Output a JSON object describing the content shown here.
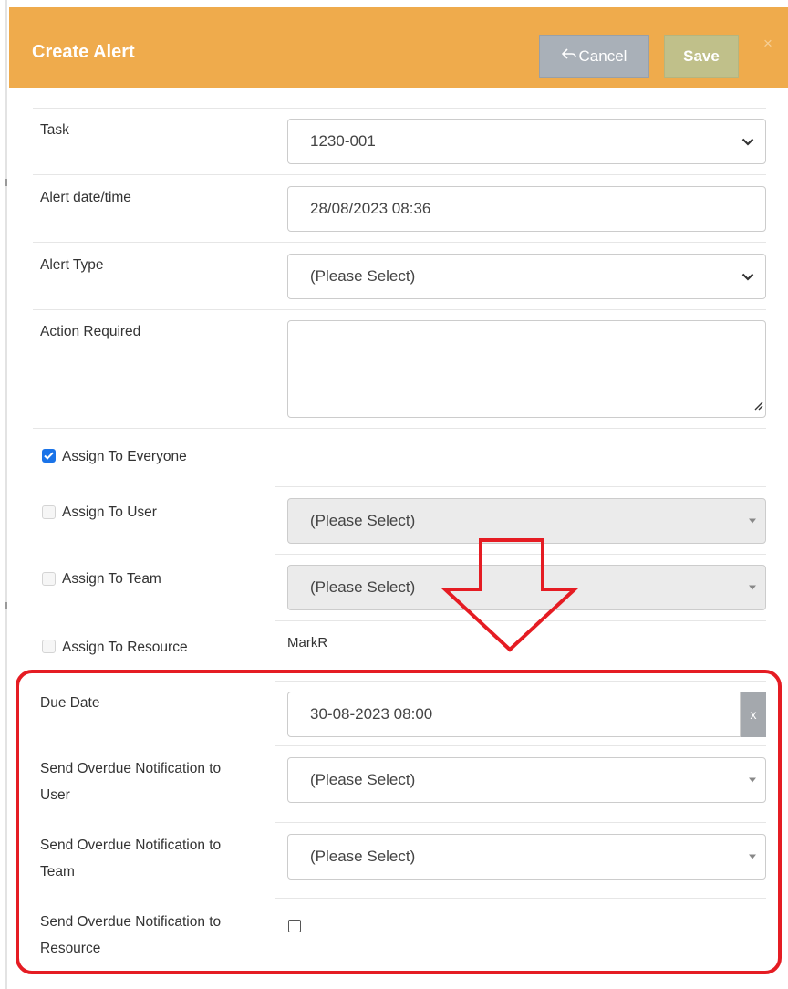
{
  "dialog": {
    "title": "Create Alert",
    "cancel_label": "Cancel",
    "save_label": "Save",
    "close_label": "×"
  },
  "form": {
    "task": {
      "label": "Task",
      "value": "1230-001"
    },
    "alert_datetime": {
      "label": "Alert date/time",
      "value": "28/08/2023 08:36"
    },
    "alert_type": {
      "label": "Alert Type",
      "value": "(Please Select)"
    },
    "action_required": {
      "label": "Action Required",
      "value": ""
    },
    "assign_everyone": {
      "label": "Assign To Everyone",
      "checked": true
    },
    "assign_user": {
      "label": "Assign To User",
      "value": "(Please Select)",
      "checked": false
    },
    "assign_team": {
      "label": "Assign To Team",
      "value": "(Please Select)",
      "checked": false
    },
    "assign_resource": {
      "label": "Assign To Resource",
      "value": "MarkR",
      "checked": false
    },
    "due_date": {
      "label": "Due Date",
      "value": "30-08-2023 08:00",
      "clear_label": "x"
    },
    "overdue_user": {
      "label_line1": "Send Overdue Notification to",
      "label_line2": "User",
      "value": "(Please Select)"
    },
    "overdue_team": {
      "label_line1": "Send Overdue Notification to",
      "label_line2": "Team",
      "value": "(Please Select)"
    },
    "overdue_resource": {
      "label_line1": "Send Overdue Notification to",
      "label_line2": "Resource",
      "checked": false
    }
  },
  "colors": {
    "header": "#efab4c",
    "cancel_button": "#a9b0b8",
    "save_button": "#c0c08a",
    "checkbox_checked": "#1a73e8",
    "annotation_red": "#e51c23"
  },
  "icons": {
    "cancel": "reply-arrow-icon",
    "dropdown": "chevron-down-icon",
    "select_caret": "caret-down-icon"
  }
}
